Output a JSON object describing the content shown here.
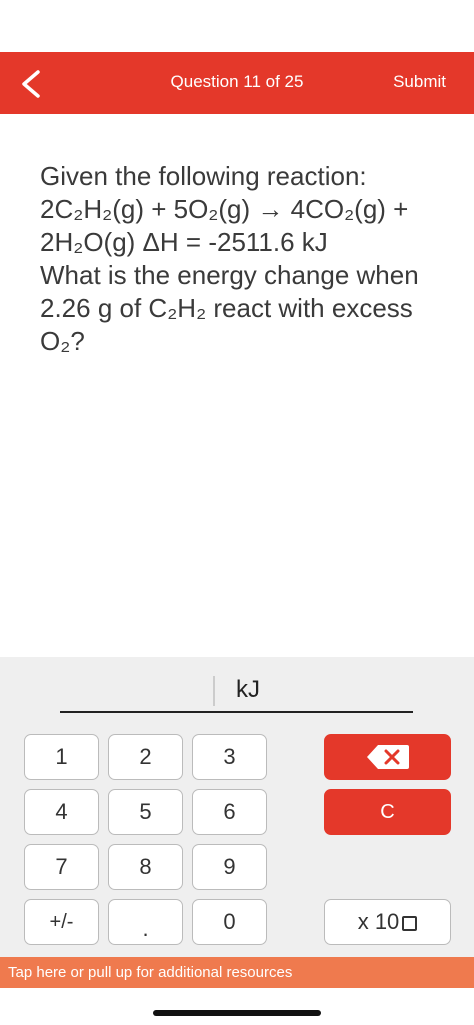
{
  "header": {
    "title": "Question 11 of 25",
    "submit_label": "Submit"
  },
  "question": {
    "lines": [
      "Given the following reaction:",
      "2C₂H₂(g) + 5O₂(g) → 4CO₂(g) +",
      "2H₂O(g)  ΔH = -2511.6 kJ",
      "What is the energy change when",
      "2.26 g of C₂H₂ react with excess",
      "O₂?"
    ]
  },
  "answer": {
    "value": "",
    "unit": "kJ"
  },
  "keypad": {
    "k1": "1",
    "k2": "2",
    "k3": "3",
    "k4": "4",
    "k5": "5",
    "k6": "6",
    "k7": "7",
    "k8": "8",
    "k9": "9",
    "sign": "+/-",
    "decimal": ".",
    "k0": "0",
    "clear": "C",
    "sci_label": "x 10"
  },
  "resources": {
    "label": "Tap here or pull up for additional resources"
  },
  "colors": {
    "header": "#e4382a",
    "resources_bar": "#ef7a4e",
    "pad_background": "#efefef"
  },
  "icons": {
    "back": "chevron-left-icon",
    "backspace": "backspace-icon",
    "exponent_box": "square-icon"
  }
}
